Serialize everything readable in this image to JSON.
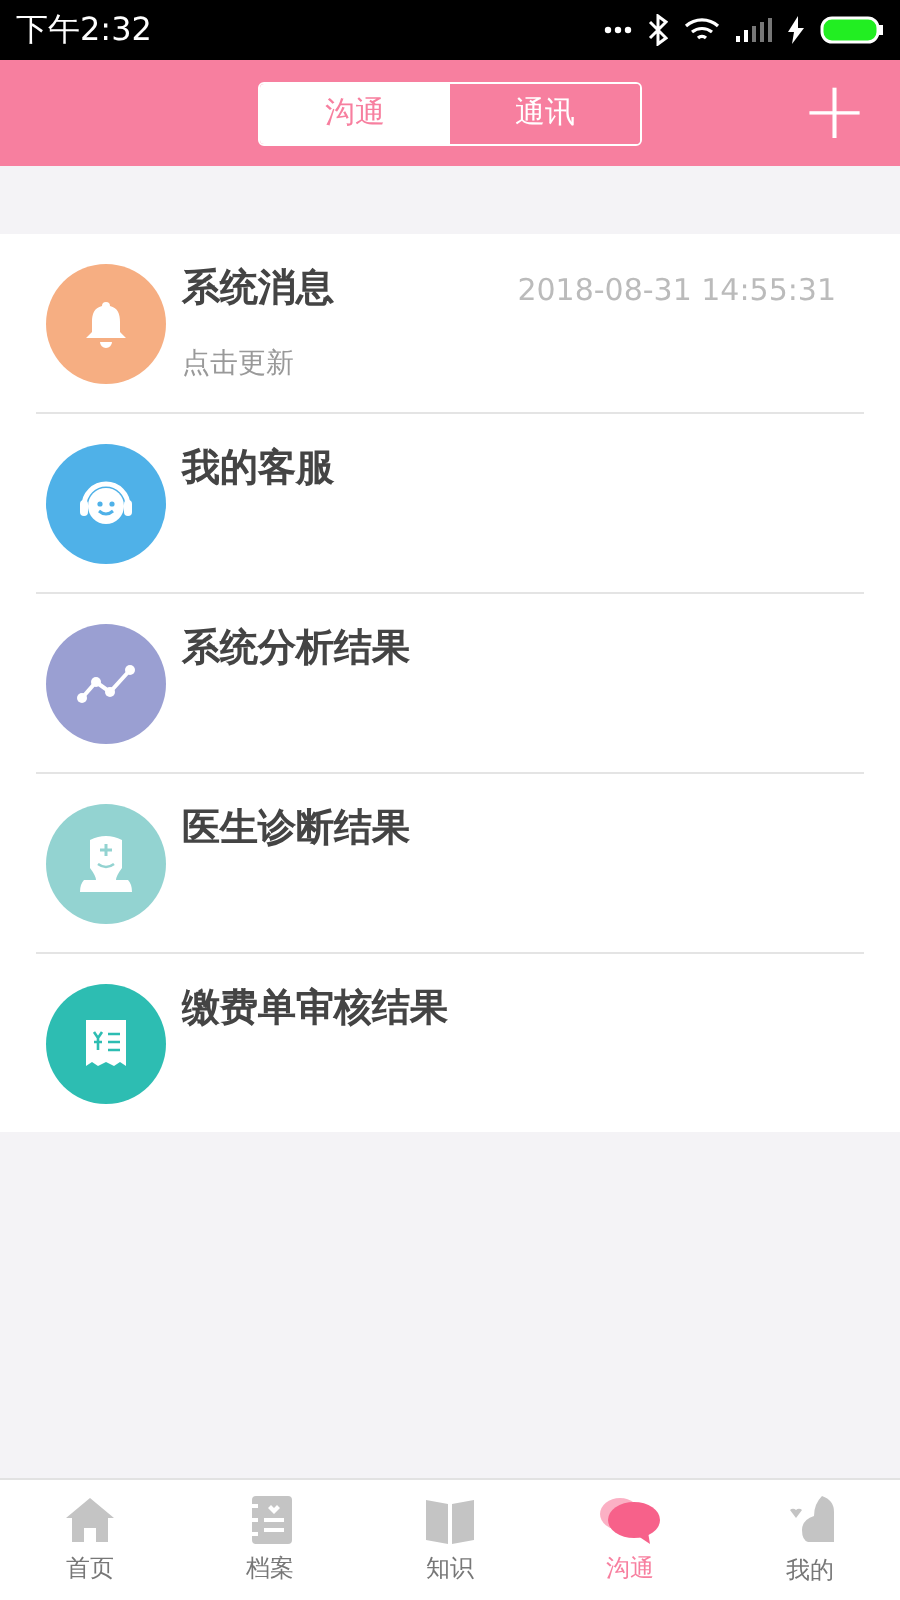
{
  "status_bar": {
    "time": "下午2:32"
  },
  "header": {
    "tabs": [
      {
        "label": "沟通",
        "selected": true
      },
      {
        "label": "通讯",
        "selected": false
      }
    ],
    "add_button": "+"
  },
  "messages": [
    {
      "title": "系统消息",
      "subtitle": "点击更新",
      "time": "2018-08-31 14:55:31",
      "color": "#f6ae82"
    },
    {
      "title": "我的客服",
      "color": "#4fb1e8"
    },
    {
      "title": "系统分析结果",
      "color": "#9a9fd2"
    },
    {
      "title": "医生诊断结果",
      "color": "#93d3d1"
    },
    {
      "title": "缴费单审核结果",
      "color": "#2dbdb2"
    }
  ],
  "bottom_nav": [
    {
      "label": "首页",
      "selected": false
    },
    {
      "label": "档案",
      "selected": false
    },
    {
      "label": "知识",
      "selected": false
    },
    {
      "label": "沟通",
      "selected": true
    },
    {
      "label": "我的",
      "selected": false
    }
  ]
}
